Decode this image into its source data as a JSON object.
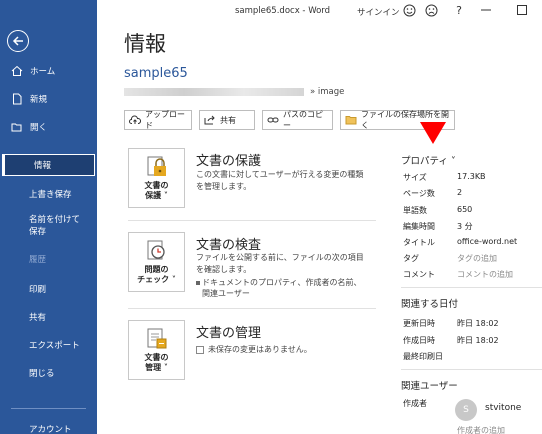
{
  "window": {
    "title": "sample65.docx - Word",
    "signin": "サインイン",
    "help": "?"
  },
  "sidebar": {
    "items": [
      {
        "label": "ホーム",
        "icon": "home-icon"
      },
      {
        "label": "新規",
        "icon": "new-doc-icon"
      },
      {
        "label": "開く",
        "icon": "folder-open-icon"
      },
      {
        "label": "情報"
      },
      {
        "label": "上書き保存"
      },
      {
        "label": "名前を付けて保存"
      },
      {
        "label": "履歴"
      },
      {
        "label": "印刷"
      },
      {
        "label": "共有"
      },
      {
        "label": "エクスポート"
      },
      {
        "label": "閉じる"
      },
      {
        "label": "アカウント"
      }
    ]
  },
  "main": {
    "title": "情報",
    "doc_name": "sample65",
    "path_suffix": "» image",
    "buttons": [
      {
        "label": "アップロード",
        "icon": "cloud-upload-icon"
      },
      {
        "label": "共有",
        "icon": "share-icon"
      },
      {
        "label": "パスのコピー",
        "icon": "link-icon"
      },
      {
        "label": "ファイルの保存場所を開く",
        "icon": "folder-icon"
      }
    ],
    "sections": [
      {
        "button_label_1": "文書の",
        "button_label_2": "保護",
        "title": "文書の保護",
        "desc": "この文書に対してユーザーが行える変更の種類を管理します。"
      },
      {
        "button_label_1": "問題の",
        "button_label_2": "チェック",
        "title": "文書の検査",
        "desc": "ファイルを公開する前に、ファイルの次の項目を確認します。",
        "bullet": "ドキュメントのプロパティ、作成者の名前、関連ユーザー"
      },
      {
        "button_label_1": "文書の",
        "button_label_2": "管理",
        "title": "文書の管理",
        "desc": "未保存の変更はありません。"
      }
    ]
  },
  "properties": {
    "heading": "プロパティ",
    "rows": [
      {
        "key": "サイズ",
        "value": "17.3KB"
      },
      {
        "key": "ページ数",
        "value": "2"
      },
      {
        "key": "単語数",
        "value": "650"
      },
      {
        "key": "編集時間",
        "value": "3 分"
      },
      {
        "key": "タイトル",
        "value": "office-word.net"
      },
      {
        "key": "タグ",
        "value": "タグの追加"
      },
      {
        "key": "コメント",
        "value": "コメントの追加"
      }
    ]
  },
  "dates": {
    "heading": "関連する日付",
    "rows": [
      {
        "key": "更新日時",
        "value": "昨日 18:02"
      },
      {
        "key": "作成日時",
        "value": "昨日 18:02"
      },
      {
        "key": "最終印刷日",
        "value": ""
      }
    ]
  },
  "users": {
    "heading": "関連ユーザー",
    "author_label": "作成者",
    "avatar_initial": "S",
    "author_name": "stvitone",
    "add_author": "作成者の追加"
  },
  "colors": {
    "sidebar": "#2b579a",
    "selected": "#1e3f72",
    "accent_red": "#ff0000"
  }
}
